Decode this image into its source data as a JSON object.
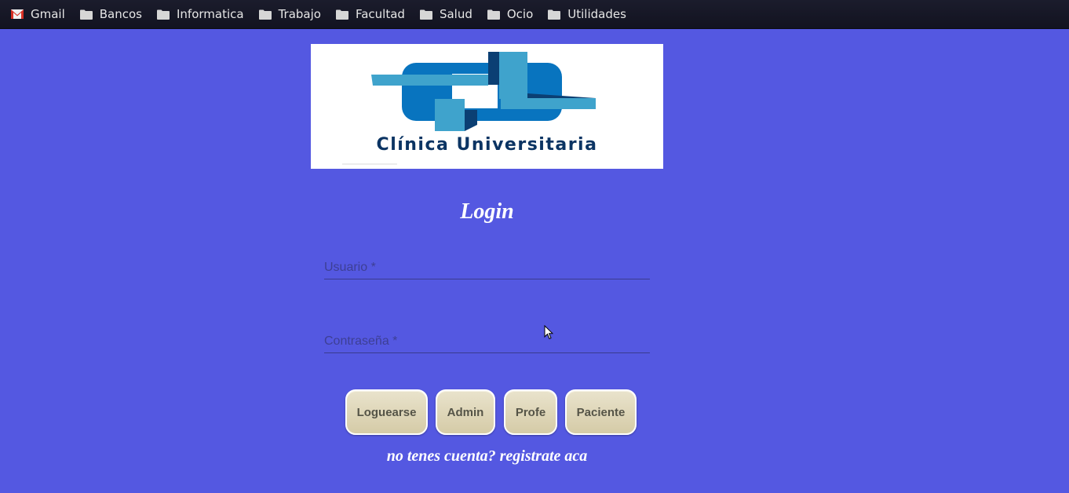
{
  "bookmarks": [
    {
      "label": "Gmail",
      "icon": "gmail-icon"
    },
    {
      "label": "Bancos",
      "icon": "folder-icon"
    },
    {
      "label": "Informatica",
      "icon": "folder-icon"
    },
    {
      "label": "Trabajo",
      "icon": "folder-icon"
    },
    {
      "label": "Facultad",
      "icon": "folder-icon"
    },
    {
      "label": "Salud",
      "icon": "folder-icon"
    },
    {
      "label": "Ocio",
      "icon": "folder-icon"
    },
    {
      "label": "Utilidades",
      "icon": "folder-icon"
    }
  ],
  "logo": {
    "text": "Clínica Universitaria"
  },
  "login": {
    "title": "Login",
    "username_placeholder": "Usuario *",
    "username_value": "",
    "password_placeholder": "Contraseña *",
    "password_value": ""
  },
  "buttons": {
    "login": "Loguearse",
    "admin": "Admin",
    "profe": "Profe",
    "paciente": "Paciente"
  },
  "register_link": "no tenes cuenta? registrate aca",
  "colors": {
    "background": "#5458e1",
    "bookmarks_bar": "#16172a",
    "button_fill": "#ddd5b5",
    "logo_dark_blue": "#0b3463",
    "logo_light_blue": "#3fa3cc",
    "logo_blue": "#0874bf"
  }
}
